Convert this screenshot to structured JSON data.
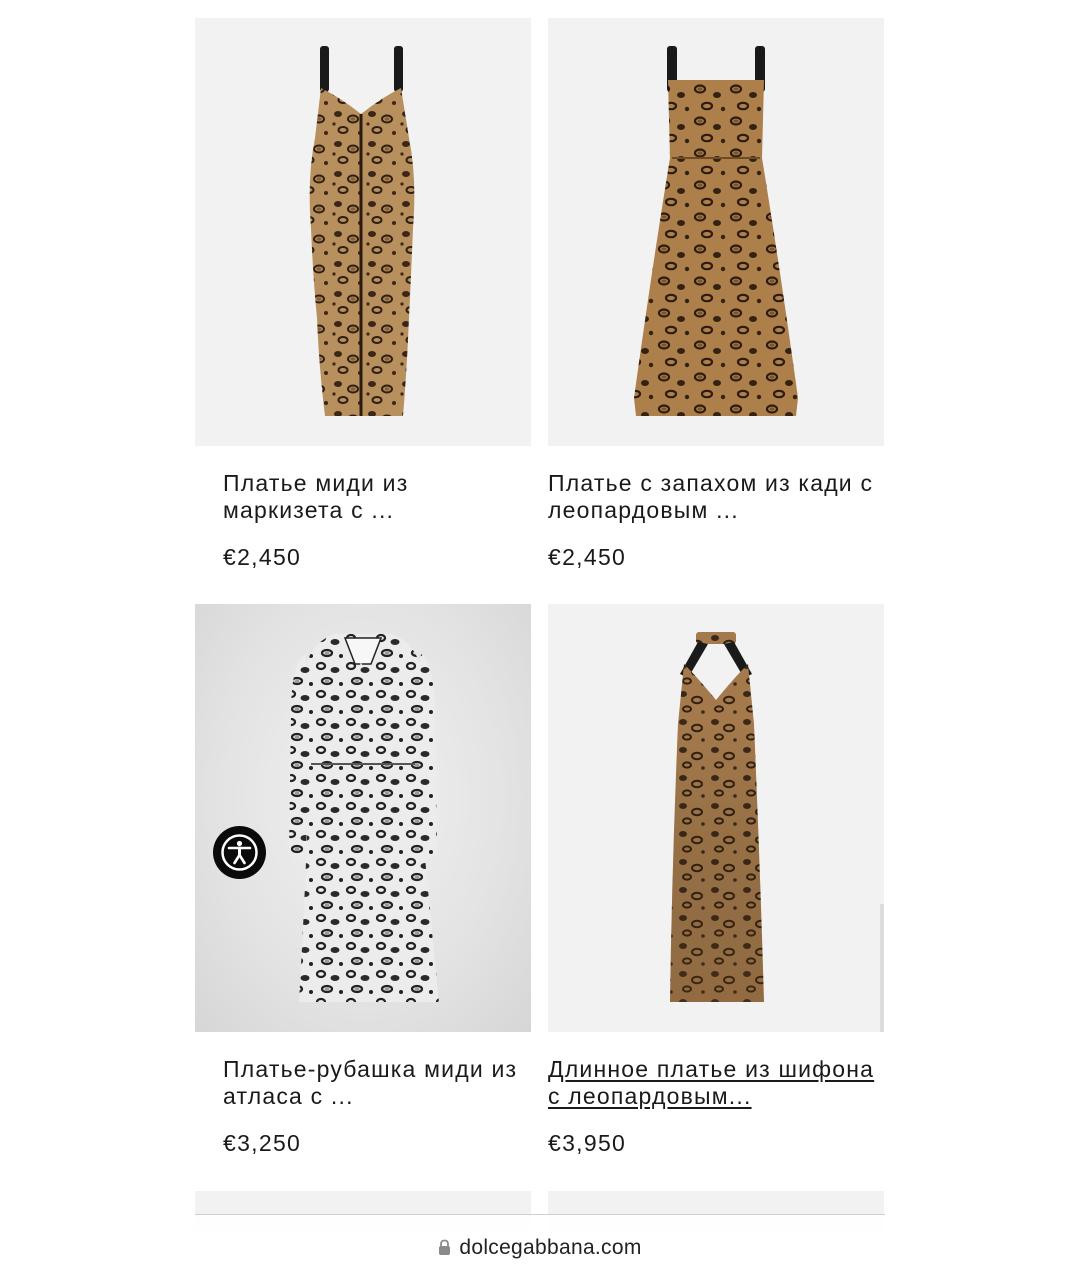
{
  "products": [
    {
      "name": "Платье миди из маркизета с ...",
      "price": "€2,450"
    },
    {
      "name": "Платье с запахом из кади с леопардовым ...",
      "price": "€2,450"
    },
    {
      "name": "Платье-рубашка миди из атласа с ...",
      "price": "€3,250"
    },
    {
      "name": "Длинное платье из шифона с леопардовым...",
      "price": "€3,950"
    }
  ],
  "address_bar": {
    "domain": "dolcegabbana.com",
    "icon": "lock-icon"
  },
  "accessibility": {
    "icon": "accessibility-icon"
  },
  "colors": {
    "leopard_base": "#b08453",
    "leopard_dark": "#3a2a1a",
    "snow_base": "#e9e9e9",
    "strap": "#1a1a1a"
  }
}
